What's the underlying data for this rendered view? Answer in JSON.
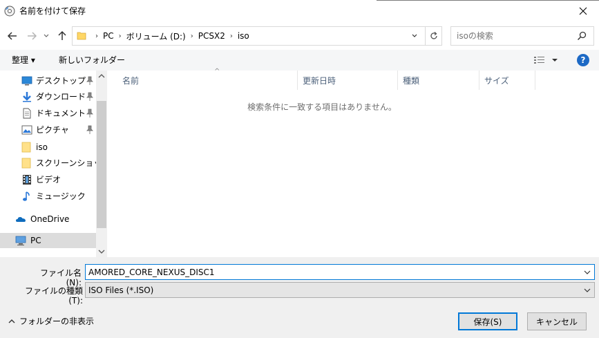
{
  "window": {
    "title": "名前を付けて保存"
  },
  "address": {
    "crumbs": [
      "PC",
      "ボリューム (D:)",
      "PCSX2",
      "iso"
    ]
  },
  "search": {
    "placeholder": "isoの検索"
  },
  "toolbar": {
    "organize_label": "整理 ▾",
    "new_folder_label": "新しいフォルダー"
  },
  "nav": {
    "items": [
      {
        "label": "デスクトップ",
        "icon": "desktop-icon",
        "pinned": true
      },
      {
        "label": "ダウンロード",
        "icon": "download-icon",
        "pinned": true
      },
      {
        "label": "ドキュメント",
        "icon": "document-icon",
        "pinned": true
      },
      {
        "label": "ピクチャ",
        "icon": "pictures-icon",
        "pinned": true
      },
      {
        "label": "iso",
        "icon": "folder-icon",
        "pinned": false
      },
      {
        "label": "スクリーンショット",
        "icon": "folder-icon",
        "pinned": false
      },
      {
        "label": "ビデオ",
        "icon": "video-icon",
        "pinned": false
      },
      {
        "label": "ミュージック",
        "icon": "music-icon",
        "pinned": false
      },
      {
        "label": "OneDrive",
        "icon": "onedrive-icon",
        "pinned": false
      },
      {
        "label": "PC",
        "icon": "pc-icon",
        "pinned": false,
        "selected": true
      }
    ]
  },
  "list": {
    "columns": [
      "名前",
      "更新日時",
      "種類",
      "サイズ"
    ],
    "empty_message": "検索条件に一致する項目はありません。"
  },
  "form": {
    "filename_label": "ファイル名(N):",
    "filename_value": "AMORED_CORE_NEXUS_DISC1",
    "filetype_label": "ファイルの種類(T):",
    "filetype_value": "ISO Files (*.ISO)",
    "hide_folders_label": "フォルダーの非表示",
    "save_label": "保存(S)",
    "cancel_label": "キャンセル"
  },
  "colors": {
    "accent": "#0078d7",
    "help": "#1c69c5",
    "folder": "#ffd766",
    "selected": "#dcdcdc"
  }
}
